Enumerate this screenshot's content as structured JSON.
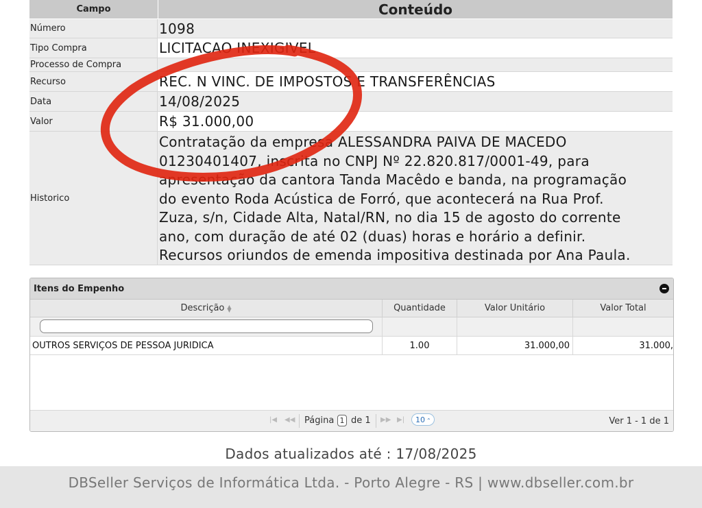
{
  "details": {
    "col_field": "Campo",
    "col_content": "Conteúdo",
    "rows": [
      {
        "label": "Número",
        "value": "1098"
      },
      {
        "label": "Tipo Compra",
        "value": "LICITACAO INEXIGIVEL"
      },
      {
        "label": "Processo de Compra",
        "value": ""
      },
      {
        "label": "Recurso",
        "value": "REC. N VINC. DE IMPOSTOS E TRANSFERÊNCIAS"
      },
      {
        "label": "Data",
        "value": "14/08/2025"
      },
      {
        "label": "Valor",
        "value": "R$ 31.000,00"
      }
    ],
    "historico_label": "Historico",
    "historico_lines": [
      "Contratação da empresa ALESSANDRA PAIVA DE MACEDO",
      "01230401407, inscrita no CNPJ Nº 22.820.817/0001-49, para",
      "apresentação da cantora Tanda Macêdo e banda, na programação",
      "do evento Roda Acústica de Forró, que acontecerá na Rua Prof.",
      "Zuza, s/n, Cidade Alta, Natal/RN, no dia 15 de agosto do corrente",
      "ano, com duração de até 02 (duas) horas e horário a definir.",
      "Recursos oriundos de emenda impositiva destinada por Ana Paula."
    ]
  },
  "items": {
    "title": "Itens do Empenho",
    "columns": [
      "Descrição",
      "Quantidade",
      "Valor Unitário",
      "Valor Total"
    ],
    "rows": [
      {
        "descricao": "OUTROS SERVIÇOS DE PESSOA JURIDICA",
        "quantidade": "1.00",
        "valor_unitario": "31.000,00",
        "valor_total": "31.000,"
      }
    ],
    "pager": {
      "page_label": "Página",
      "page_value": "1",
      "of_label": "de 1",
      "page_size": "10",
      "summary": "Ver 1 - 1 de 1"
    }
  },
  "updated": "Dados atualizados até : 17/08/2025",
  "footer": "DBSeller Serviços de Informática Ltda. - Porto Alegre - RS | www.dbseller.com.br",
  "colors": {
    "annotation": "#e0250f",
    "header_bg": "#c9c9c9",
    "row_bg": "#ececec"
  }
}
